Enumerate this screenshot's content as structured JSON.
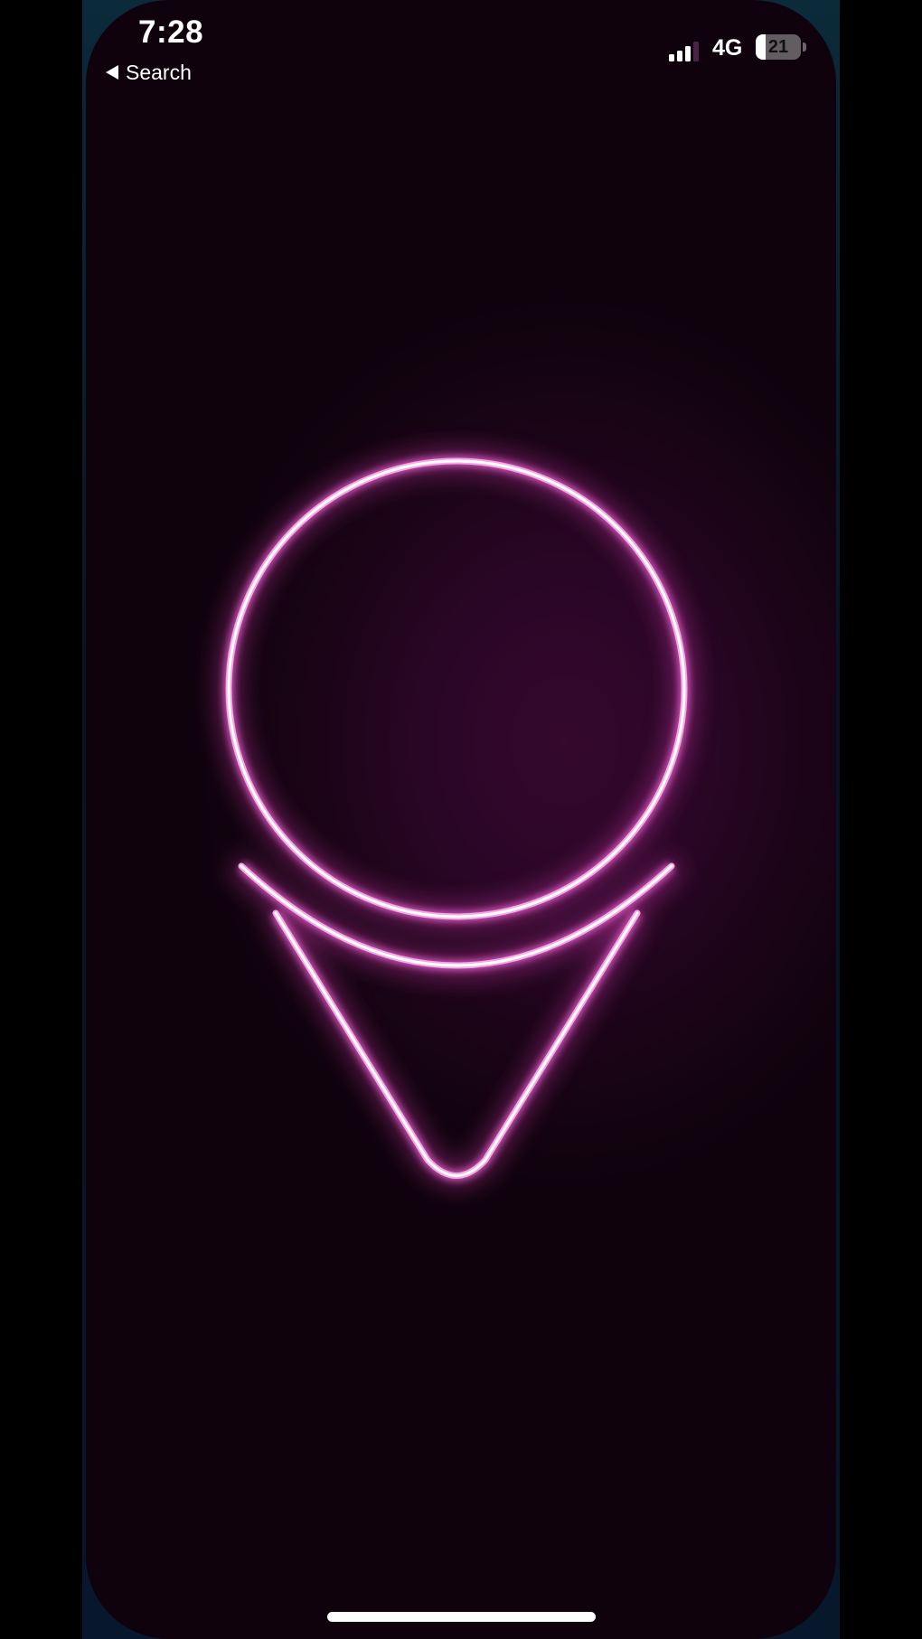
{
  "status_bar": {
    "time": "7:28",
    "back_label": "Search",
    "network": "4G",
    "battery_level": "21",
    "battery_fraction": 0.21
  },
  "content": {
    "icon": "location-pin-icon",
    "glow_color": "#e25cc8",
    "core_color": "#ffffff"
  }
}
